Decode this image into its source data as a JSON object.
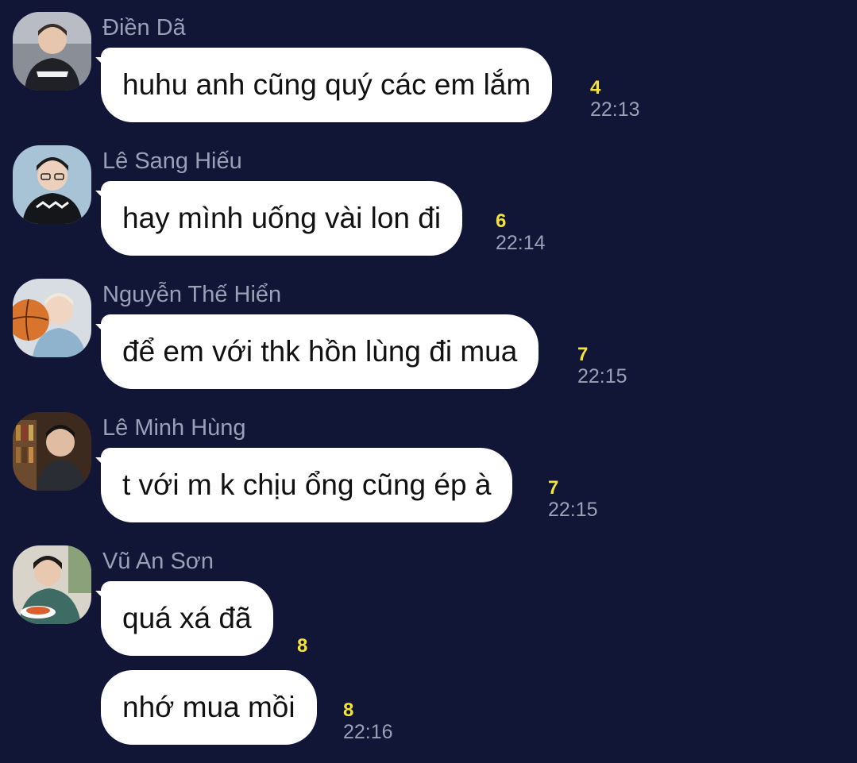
{
  "colors": {
    "background": "#111536",
    "bubble": "#ffffff",
    "sender_name": "#9aa0b6",
    "reaction_count": "#f5e33a",
    "timestamp": "#9aa0b6"
  },
  "messages": [
    {
      "sender": "Điền Dã",
      "text": "huhu anh cũng quý các em lắm",
      "count": "4",
      "time": "22:13",
      "avatar_icon": "user-avatar-icon"
    },
    {
      "sender": "Lê Sang Hiếu",
      "text": "hay mình uống vài lon đi",
      "count": "6",
      "time": "22:14",
      "avatar_icon": "user-avatar-icon"
    },
    {
      "sender": "Nguyễn Thế Hiển",
      "text": "để em với thk hồn lùng đi mua",
      "count": "7",
      "time": "22:15",
      "avatar_icon": "user-avatar-icon"
    },
    {
      "sender": "Lê Minh Hùng",
      "text": "t với m k chịu ổng cũng ép à",
      "count": "7",
      "time": "22:15",
      "avatar_icon": "user-avatar-icon"
    },
    {
      "sender": "Vũ An Sơn",
      "text": "quá xá đã",
      "count": "8",
      "time": "",
      "avatar_icon": "user-avatar-icon"
    },
    {
      "sender": "",
      "text": "nhớ mua mồi",
      "count": "8",
      "time": "22:16",
      "avatar_icon": ""
    }
  ]
}
